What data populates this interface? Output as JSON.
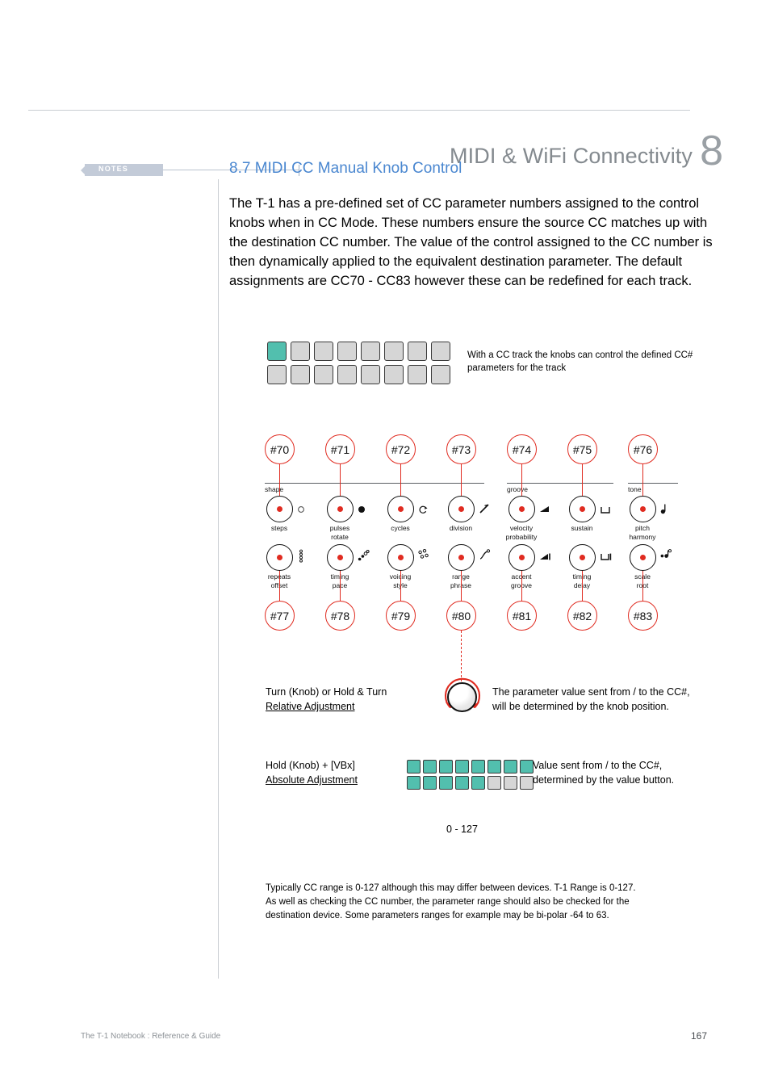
{
  "header": {
    "title": "MIDI & WiFi Connectivity",
    "chapter": "8"
  },
  "notes": {
    "label": "NOTES"
  },
  "section": {
    "title": "8.7 MIDI CC Manual Knob Control"
  },
  "intro": {
    "text": "The T-1 has a pre-defined set of CC parameter numbers assigned to the control knobs when in CC Mode. These numbers ensure the source CC matches up with the destination CC number. The value of the control assigned to the CC number is then dynamically applied to the equivalent destination parameter. The default assignments are CC70 -  CC83 however these can be redefined for each track."
  },
  "pad_grid": {
    "columns": 8,
    "rows": 2,
    "active_color": "#52bfae",
    "inactive_color": "#d6d6d6",
    "top_row_states": [
      "on",
      "off",
      "off",
      "off",
      "off",
      "off",
      "off",
      "off"
    ],
    "bottom_row_states": [
      "off",
      "off",
      "off",
      "off",
      "off",
      "off",
      "off",
      "off"
    ],
    "caption": "With a CC track the knobs can control the defined CC# parameters for the track"
  },
  "knob_groups": [
    {
      "name": "shape"
    },
    {
      "name": "groove"
    },
    {
      "name": "tone"
    }
  ],
  "knobs_row_top": [
    {
      "cc": "#70",
      "label_line1": "steps",
      "label_line2": "",
      "icon": "hollow-circle"
    },
    {
      "cc": "#71",
      "label_line1": "pulses",
      "label_line2": "rotate",
      "icon": "filled-circle"
    },
    {
      "cc": "#72",
      "label_line1": "cycles",
      "label_line2": "",
      "icon": "loop-arc"
    },
    {
      "cc": "#73",
      "label_line1": "division",
      "label_line2": "",
      "icon": "slash-line"
    },
    {
      "cc": "#74",
      "label_line1": "velocity",
      "label_line2": "probability",
      "icon": "ramp-triangle"
    },
    {
      "cc": "#75",
      "label_line1": "sustain",
      "label_line2": "",
      "icon": "bracket-u"
    },
    {
      "cc": "#76",
      "label_line1": "pitch",
      "label_line2": "harmony",
      "icon": "note"
    }
  ],
  "knobs_row_bottom": [
    {
      "cc": "#77",
      "label_line1": "repeats",
      "label_line2": "offset",
      "icon": "four-dots"
    },
    {
      "cc": "#78",
      "label_line1": "timing",
      "label_line2": "pace",
      "icon": "chain-dots"
    },
    {
      "cc": "#79",
      "label_line1": "voicing",
      "label_line2": "style",
      "icon": "scatter-dots"
    },
    {
      "cc": "#80",
      "label_line1": "range",
      "label_line2": "phrase",
      "icon": "curve-dot"
    },
    {
      "cc": "#81",
      "label_line1": "accent",
      "label_line2": "groove",
      "icon": "ramp-bar"
    },
    {
      "cc": "#82",
      "label_line1": "timing",
      "label_line2": "delay",
      "icon": "bracket-bar"
    },
    {
      "cc": "#83",
      "label_line1": "scale",
      "label_line2": "root",
      "icon": "dot-note"
    }
  ],
  "relative": {
    "left_line1": "Turn (Knob) or Hold & Turn",
    "left_line2": "Relative Adjustment",
    "right_line1": "The parameter value sent from / to the CC#,",
    "right_line2": "will be determined by the knob position."
  },
  "absolute": {
    "left_line1": "Hold (Knob) + [VBx]",
    "left_line2": "Absolute Adjustment",
    "right_line1": "Value sent from / to the CC#,",
    "right_line2": "determined by the value button.",
    "top_row_states": [
      "on",
      "on",
      "on",
      "on",
      "on",
      "on",
      "on",
      "on"
    ],
    "bottom_row_states": [
      "on",
      "on",
      "on",
      "on",
      "on",
      "off",
      "off",
      "off"
    ],
    "range_label": "0 - 127"
  },
  "footnote": {
    "line1": "Typically CC range is 0-127 although this may differ between devices. T-1 Range is 0-127.",
    "line2": "As well as checking the CC number, the parameter range should also be checked for the",
    "line3": "destination device. Some parameters ranges for example may be bi-polar -64 to 63."
  },
  "footer": {
    "left": "The T-1 Notebook : Reference & Guide",
    "page": "167"
  },
  "colors": {
    "accent_red": "#e02b20",
    "heading_blue": "#4a87d0",
    "teal": "#52bfae",
    "pad_gray": "#d6d6d6",
    "header_gray": "#848a8f"
  }
}
